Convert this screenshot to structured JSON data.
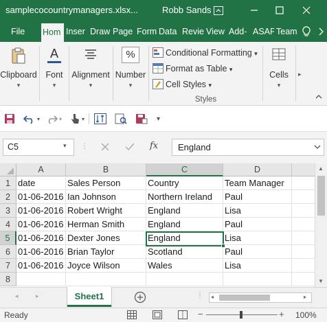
{
  "titlebar": {
    "filename": "samplecocountrymanagers.xlsx...",
    "user": "Robb Sands",
    "bg_color": "#217346"
  },
  "tabs": [
    "File",
    "Hom",
    "Inser",
    "Draw",
    "Page",
    "Form",
    "Data",
    "Revie",
    "View",
    "Add-",
    "ASAP",
    "Team"
  ],
  "active_tab": "Hom",
  "ribbon": {
    "clipboard": "Clipboard",
    "font": "Font",
    "alignment": "Alignment",
    "number": "Number",
    "number_icon": "%",
    "font_icon": "A",
    "conditional_formatting": "Conditional Formatting",
    "format_as_table": "Format as Table",
    "cell_styles": "Cell Styles",
    "styles_group": "Styles",
    "cells": "Cells"
  },
  "formula_bar": {
    "name_box": "C5",
    "fx": "fx",
    "value": "England"
  },
  "grid": {
    "columns": [
      "A",
      "B",
      "C",
      "D"
    ],
    "selected_column": "C",
    "selected_row": "5",
    "rows": [
      {
        "num": "1",
        "cells": [
          "date",
          "Sales Person",
          "Country",
          "Team Manager"
        ]
      },
      {
        "num": "2",
        "cells": [
          "01-06-2016",
          "Ian Johnson",
          "Northern Ireland",
          "Paul"
        ]
      },
      {
        "num": "3",
        "cells": [
          "01-06-2016",
          "Robert Wright",
          "England",
          "Lisa"
        ]
      },
      {
        "num": "4",
        "cells": [
          "01-06-2016",
          "Herman Smith",
          "England",
          "Paul"
        ]
      },
      {
        "num": "5",
        "cells": [
          "01-06-2016",
          "Dexter Jones",
          "England",
          "Lisa"
        ]
      },
      {
        "num": "6",
        "cells": [
          "01-06-2016",
          "Brian Taylor",
          "Scotland",
          "Paul"
        ]
      },
      {
        "num": "7",
        "cells": [
          "01-06-2016",
          "Joyce Wilson",
          "Wales",
          "Lisa"
        ]
      },
      {
        "num": "8",
        "cells": [
          "",
          "",
          "",
          ""
        ]
      }
    ]
  },
  "sheet_tabs": {
    "active": "Sheet1"
  },
  "status": {
    "ready": "Ready",
    "zoom": "100%"
  }
}
